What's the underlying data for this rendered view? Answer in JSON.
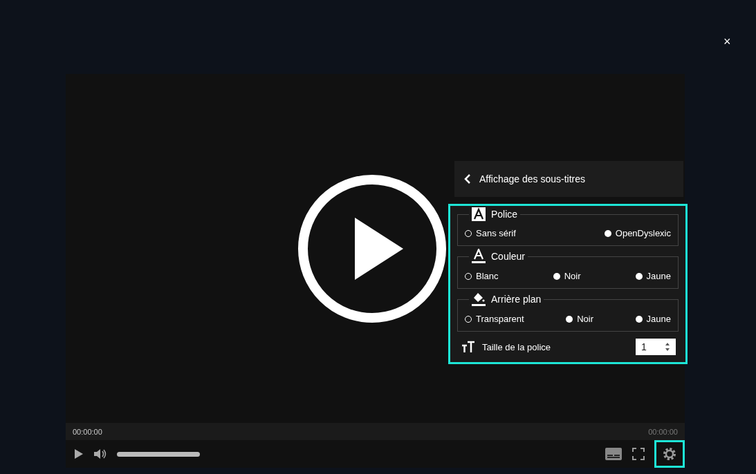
{
  "close_label": "×",
  "panel": {
    "title": "Affichage des sous-titres",
    "groups": [
      {
        "kind": "font",
        "legend": "Police",
        "options": [
          {
            "label": "Sans sérif",
            "selected": true
          },
          {
            "label": "OpenDyslexic",
            "selected": false
          }
        ]
      },
      {
        "kind": "color",
        "legend": "Couleur",
        "options": [
          {
            "label": "Blanc",
            "selected": true
          },
          {
            "label": "Noir",
            "selected": false
          },
          {
            "label": "Jaune",
            "selected": false
          }
        ]
      },
      {
        "kind": "background",
        "legend": "Arrière plan",
        "options": [
          {
            "label": "Transparent",
            "selected": true
          },
          {
            "label": "Noir",
            "selected": false
          },
          {
            "label": "Jaune",
            "selected": false
          }
        ]
      }
    ],
    "size": {
      "label": "Taille de la police",
      "value": "1"
    }
  },
  "player": {
    "progress": {
      "level": 0
    },
    "current_time": "00:00:00",
    "duration": "00:00:00",
    "volume": {
      "level": 1
    }
  }
}
